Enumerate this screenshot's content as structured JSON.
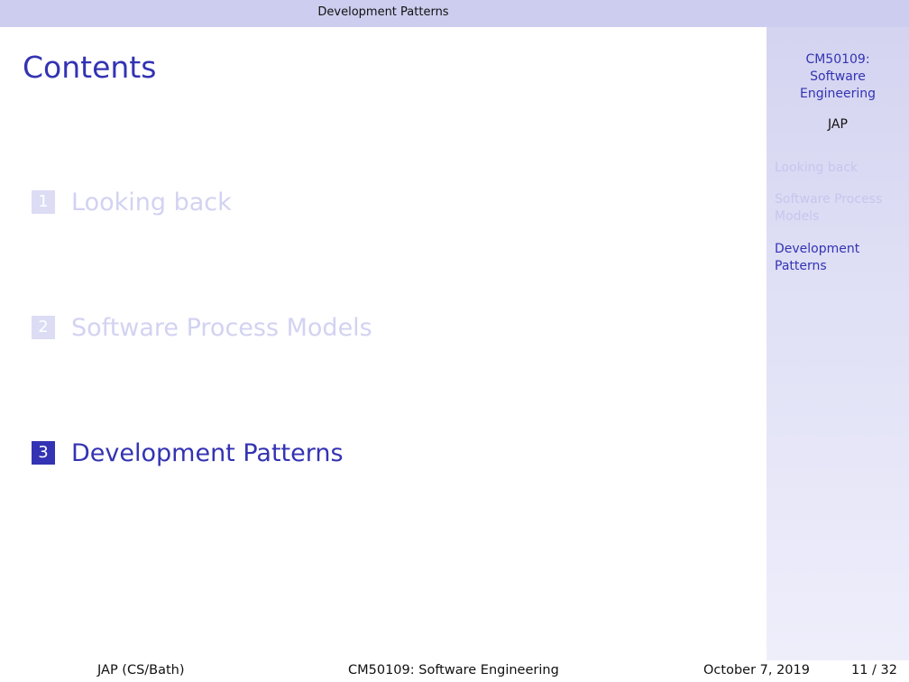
{
  "header": {
    "section_title": "Development Patterns"
  },
  "sidebar": {
    "course_title_line1": "CM50109:",
    "course_title_line2": "Software",
    "course_title_line3": "Engineering",
    "author": "JAP",
    "sections": [
      {
        "label_line1": "Looking back",
        "label_line2": "",
        "current": false
      },
      {
        "label_line1": "Software Process",
        "label_line2": "Models",
        "current": false
      },
      {
        "label_line1": "Development",
        "label_line2": "Patterns",
        "current": true
      }
    ]
  },
  "slide": {
    "title": "Contents",
    "toc": [
      {
        "number": "1",
        "label": "Looking back",
        "current": false
      },
      {
        "number": "2",
        "label": "Software Process Models",
        "current": false
      },
      {
        "number": "3",
        "label": "Development Patterns",
        "current": true
      }
    ]
  },
  "footer": {
    "author": "JAP  (CS/Bath)",
    "title": "CM50109: Software Engineering",
    "date": "October 7, 2019",
    "page": "11 / 32"
  },
  "colors": {
    "accent": "#3333b3",
    "inactive": "#d2d2f2",
    "bar": "#cdcdef"
  }
}
